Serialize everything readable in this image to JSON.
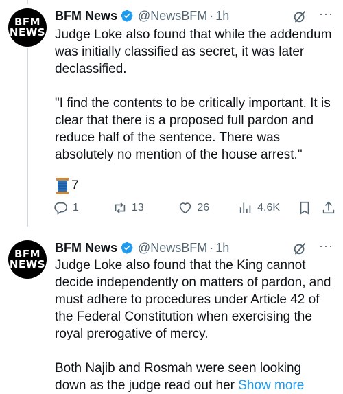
{
  "tweets": [
    {
      "author": {
        "name": "BFM News",
        "handle": "@NewsBFM",
        "time": "1h",
        "avatar_lines": [
          "BFM",
          "NEWS"
        ]
      },
      "paragraphs": [
        "Judge Loke also found that while the addendum was initially classified as secret, it was later declassified.",
        "\"I find the contents to be critically important. It is clear that there is a proposed full pardon and reduce half of the sentence. There was absolutely no mention of the house arrest.\""
      ],
      "emoji_count": "7",
      "actions": {
        "replies": "1",
        "reposts": "13",
        "likes": "26",
        "views": "4.6K"
      }
    },
    {
      "author": {
        "name": "BFM News",
        "handle": "@NewsBFM",
        "time": "1h",
        "avatar_lines": [
          "BFM",
          "NEWS"
        ]
      },
      "paragraphs": [
        "Judge Loke also found that the King cannot decide independently on matters of pardon, and must adhere to procedures under Article 42 of the Federal Constitution when exercising the royal prerogative of mercy.",
        "Both Najib and Rosmah were seen looking down as the judge read out her"
      ],
      "show_more": "Show more"
    }
  ],
  "colors": {
    "verified": "#1d9bf0",
    "muted": "#536471",
    "link": "#1d9bf0",
    "text": "#0f1419",
    "thread_line": "#cfd9de"
  },
  "icons": [
    "verified-badge-icon",
    "grok-icon",
    "more-icon",
    "spool-emoji-icon",
    "reply-icon",
    "repost-icon",
    "like-icon",
    "views-icon",
    "bookmark-icon",
    "share-icon"
  ]
}
